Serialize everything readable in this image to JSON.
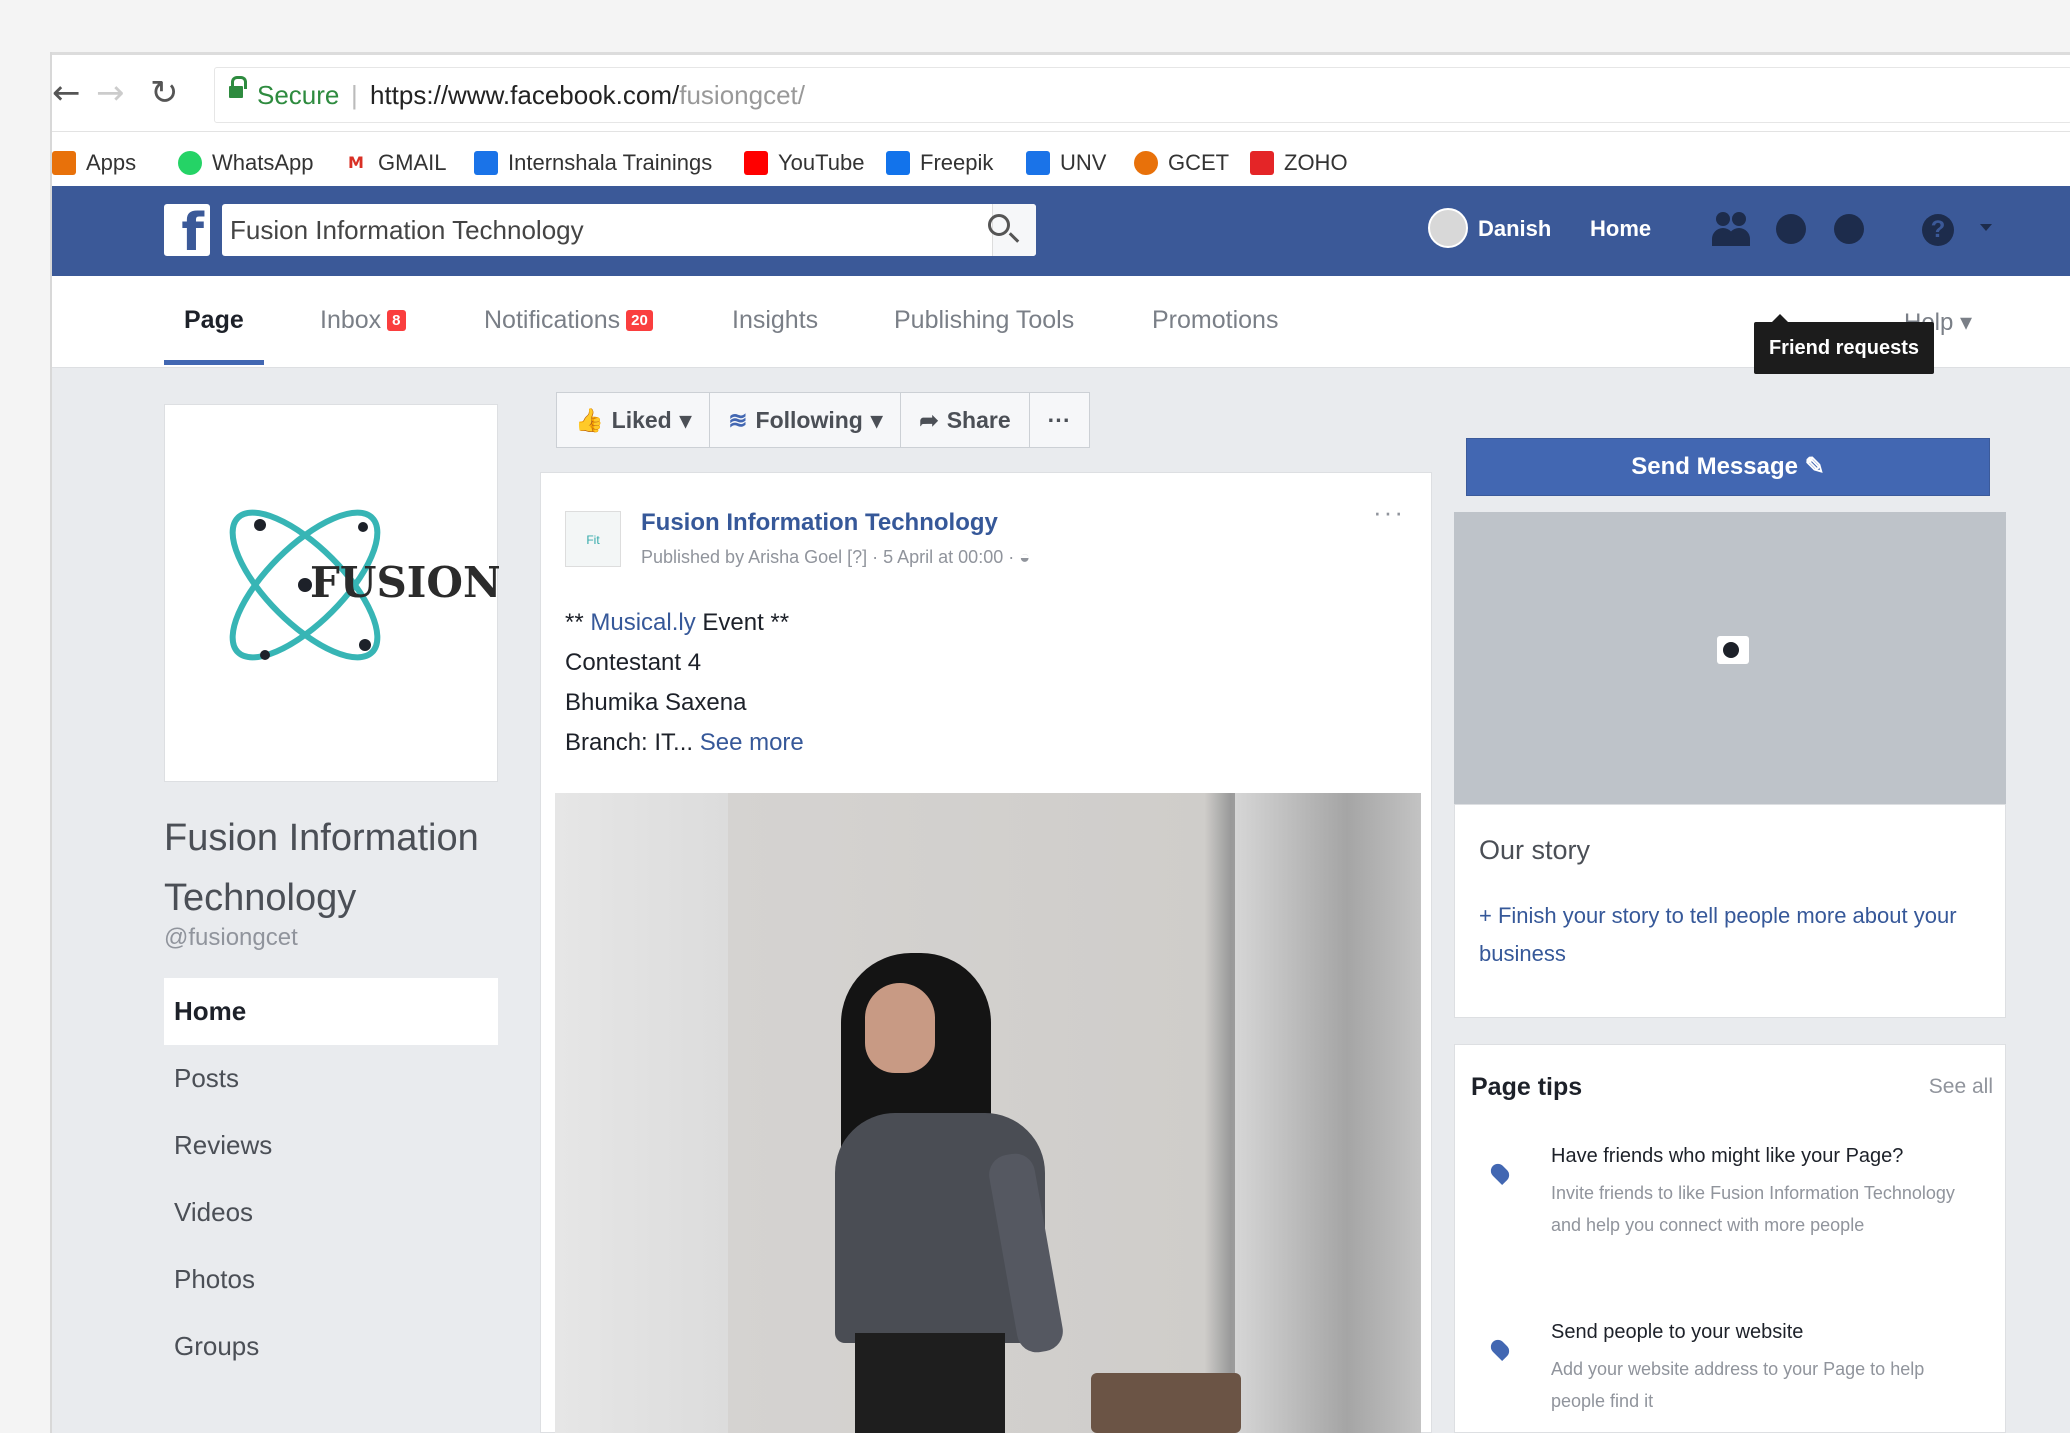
{
  "browser": {
    "secure_label": "Secure",
    "url_host": "https://www.facebook.com/",
    "url_path": "fusiongcet/",
    "bookmarks": [
      {
        "label": "Apps",
        "icon": "apps-grid-icon",
        "color": "#e8710a"
      },
      {
        "label": "WhatsApp",
        "icon": "whatsapp-icon",
        "color": "#25d366"
      },
      {
        "label": "GMAIL",
        "icon": "gmail-icon",
        "color": "#d93025"
      },
      {
        "label": "Internshala Trainings",
        "icon": "internshala-icon",
        "color": "#1a73e8"
      },
      {
        "label": "YouTube",
        "icon": "youtube-icon",
        "color": "#ff0000"
      },
      {
        "label": "Freepik",
        "icon": "freepik-icon",
        "color": "#1273eb"
      },
      {
        "label": "UNV",
        "icon": "unv-icon",
        "color": "#1a73e8"
      },
      {
        "label": "GCET",
        "icon": "gcet-icon",
        "color": "#e8710a"
      },
      {
        "label": "ZOHO",
        "icon": "zoho-icon",
        "color": "#e42527"
      }
    ]
  },
  "fbbar": {
    "search_value": "Fusion Information Technology",
    "user_name": "Danish",
    "home_label": "Home",
    "tooltip": "Friend requests",
    "brand_color": "#3b5998"
  },
  "tabs": {
    "items": [
      {
        "label": "Page"
      },
      {
        "label": "Inbox",
        "badge": "8"
      },
      {
        "label": "Notifications",
        "badge": "20"
      },
      {
        "label": "Insights"
      },
      {
        "label": "Publishing Tools"
      },
      {
        "label": "Promotions"
      }
    ],
    "help_label": "Help"
  },
  "left": {
    "logo_text": "FUSION",
    "page_name": "Fusion Information Technology",
    "handle": "@fusiongcet",
    "nav": [
      "Home",
      "Posts",
      "Reviews",
      "Videos",
      "Photos",
      "Groups"
    ]
  },
  "actions": {
    "liked": "Liked",
    "following": "Following",
    "share": "Share",
    "more": "···"
  },
  "post": {
    "avatar_text": "Fit",
    "title": "Fusion Information Technology",
    "meta": "Published by Arisha Goel [?] · 5 April at 00:00 · ",
    "line1_prefix": "** ",
    "line1_link": "Musical.ly",
    "line1_suffix": " Event **",
    "line2": "Contestant 4",
    "line3": "Bhumika Saxena",
    "line4_prefix": "Branch: IT... ",
    "line4_link": "See more",
    "more": "···"
  },
  "right": {
    "send_message": "Send Message",
    "story_title": "Our story",
    "story_text": "+ Finish your story to tell people more about your business",
    "tips_title": "Page tips",
    "tips_see_all": "See all",
    "tips": [
      {
        "heading": "Have friends who might like your Page?",
        "desc": "Invite friends to like Fusion Information Technology and help you connect with more people"
      },
      {
        "heading": "Send people to your website",
        "desc": "Add your website address to your Page to help people find it"
      }
    ]
  }
}
